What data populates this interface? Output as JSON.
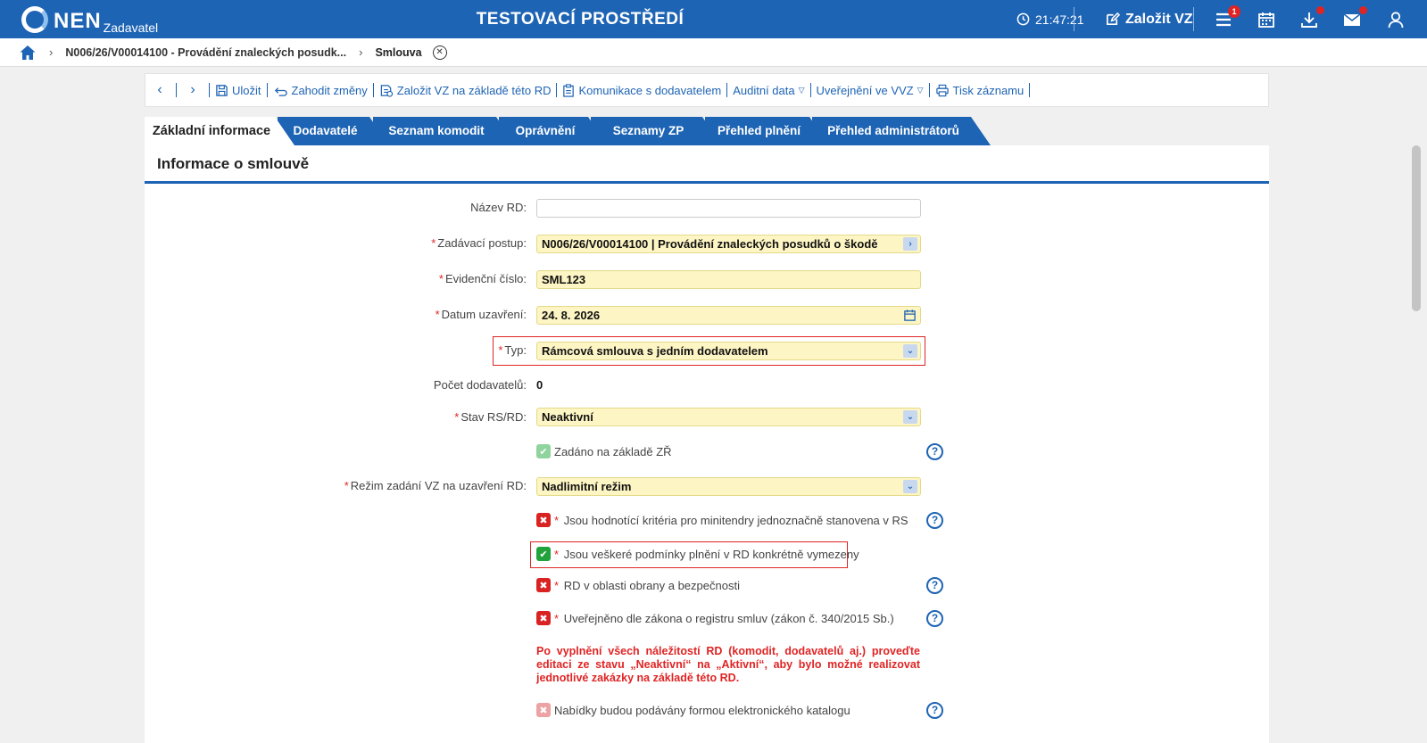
{
  "topbar": {
    "logo_text": "NEN",
    "logo_sub": "Zadavatel",
    "env_title": "TESTOVACÍ PROSTŘEDÍ",
    "clock": "21:47:21",
    "create_label": "Založit VZ",
    "menu_badge": "1",
    "icons": [
      "menu-icon",
      "calendar-icon",
      "download-icon",
      "mail-icon",
      "user-icon"
    ]
  },
  "breadcrumb": {
    "item": "N006/26/V00014100 - Provádění znaleckých posudk...",
    "current": "Smlouva"
  },
  "toolbar": {
    "save": "Uložit",
    "discard": "Zahodit změny",
    "create_vz": "Založit VZ na základě této RD",
    "communication": "Komunikace s dodavatelem",
    "audit": "Auditní data",
    "publish": "Uveřejnění ve VVZ",
    "print": "Tisk záznamu"
  },
  "tabs": [
    {
      "label": "Základní informace",
      "active": true
    },
    {
      "label": "Dodavatelé"
    },
    {
      "label": "Seznam komodit"
    },
    {
      "label": "Oprávnění"
    },
    {
      "label": "Seznamy ZP"
    },
    {
      "label": "Přehled plnění"
    },
    {
      "label": "Přehled administrátorů"
    }
  ],
  "panel": {
    "title": "Informace o smlouvě"
  },
  "form": {
    "nazev_label": "Název RD:",
    "nazev_value": "",
    "postup_label": "Zadávací postup:",
    "postup_value": "N006/26/V00014100 | Provádění znaleckých posudků o škodě",
    "evid_label": "Evidenční číslo:",
    "evid_value": "SML123",
    "datum_label": "Datum uzavření:",
    "datum_value": "24. 8. 2026",
    "typ_label": "Typ:",
    "typ_value": "Rámcová smlouva s jedním dodavatelem",
    "pocet_label": "Počet dodavatelů:",
    "pocet_value": "0",
    "stav_label": "Stav RS/RD:",
    "stav_value": "Neaktivní",
    "zr_label": "Zadáno na základě ZŘ",
    "rezim_label": "Režim zadání VZ na uzavření RD:",
    "rezim_value": "Nadlimitní režim",
    "krit_label": "Jsou hodnotící kritéria pro minitendry jednoznačně stanovena v RS",
    "podm_label": "Jsou veškeré podmínky plnění v RD konkrétně vymezeny",
    "obrana_label": "RD v oblasti obrany a bezpečnosti",
    "registr_label": "Uveřejněno dle zákona o registru smluv (zákon č. 340/2015 Sb.)",
    "warning": "Po vyplnění všech náležitostí RD (komodit, dodavatelů aj.) proveďte editaci ze stavu „Neaktivní“ na „Aktivní“, aby bylo možné realizovat jednotlivé zakázky na základě této RD.",
    "katalog_label": "Nabídky budou podávány formou elektronického katalogu",
    "help_symbol": "?",
    "required_mark": "*",
    "check_symbol": "✔",
    "cross_symbol": "✖"
  },
  "colors": {
    "brand": "#1e64b4",
    "required": "#e02424",
    "field_yellow": "#fdf5c4",
    "check_green": "#22a23c",
    "cross_red": "#d92323"
  }
}
